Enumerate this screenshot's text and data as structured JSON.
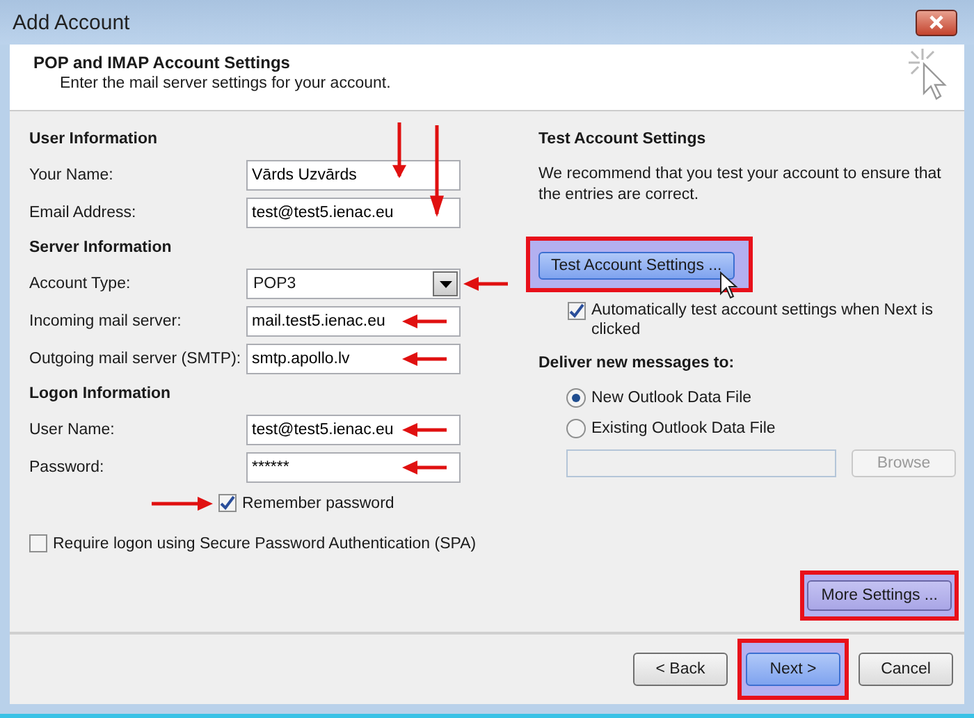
{
  "window": {
    "title": "Add Account"
  },
  "header": {
    "title": "POP and IMAP Account Settings",
    "subtitle": "Enter the mail server settings for your account."
  },
  "sections": [
    {
      "heading": "User Information",
      "fields": [
        {
          "label": "Your Name:",
          "value": "Vārds Uzvārds",
          "kind": "text",
          "arrow": true
        },
        {
          "label": "Email Address:",
          "value": "test@test5.ienac.eu",
          "kind": "text",
          "arrow": true
        }
      ]
    },
    {
      "heading": "Server Information",
      "fields": [
        {
          "label": "Account Type:",
          "value": "POP3",
          "kind": "dropdown",
          "arrow": true
        },
        {
          "label": "Incoming mail server:",
          "value": "mail.test5.ienac.eu",
          "kind": "text",
          "arrow": true
        },
        {
          "label": "Outgoing mail server (SMTP):",
          "value": "smtp.apollo.lv",
          "kind": "text",
          "arrow": true
        }
      ]
    },
    {
      "heading": "Logon Information",
      "fields": [
        {
          "label": "User Name:",
          "value": "test@test5.ienac.eu",
          "kind": "text",
          "arrow": true
        },
        {
          "label": "Password:",
          "value": "******",
          "kind": "text",
          "arrow": true
        }
      ]
    }
  ],
  "remember": {
    "label": "Remember password",
    "checked": true,
    "arrow": true
  },
  "spa": {
    "label": "Require logon using Secure Password Authentication (SPA)",
    "checked": false
  },
  "test": {
    "heading": "Test Account Settings",
    "text": "We recommend that you test your account to ensure that the entries are correct.",
    "button": {
      "label": "Test Account Settings ...",
      "highlighted": true
    },
    "auto": {
      "label": "Automatically test account settings when Next is clicked",
      "checked": true
    }
  },
  "deliver": {
    "heading": "Deliver new messages to:",
    "options": [
      {
        "label": "New Outlook Data File",
        "selected": true
      },
      {
        "label": "Existing Outlook Data File",
        "selected": false
      }
    ],
    "browse": {
      "label": "Browse",
      "disabled": true
    }
  },
  "more": {
    "label": "More Settings ...",
    "highlighted": true
  },
  "footer": [
    {
      "label": "< Back",
      "highlighted": false,
      "default": false
    },
    {
      "label": "Next >",
      "highlighted": true,
      "default": true
    },
    {
      "label": "Cancel",
      "highlighted": false,
      "default": false
    }
  ]
}
